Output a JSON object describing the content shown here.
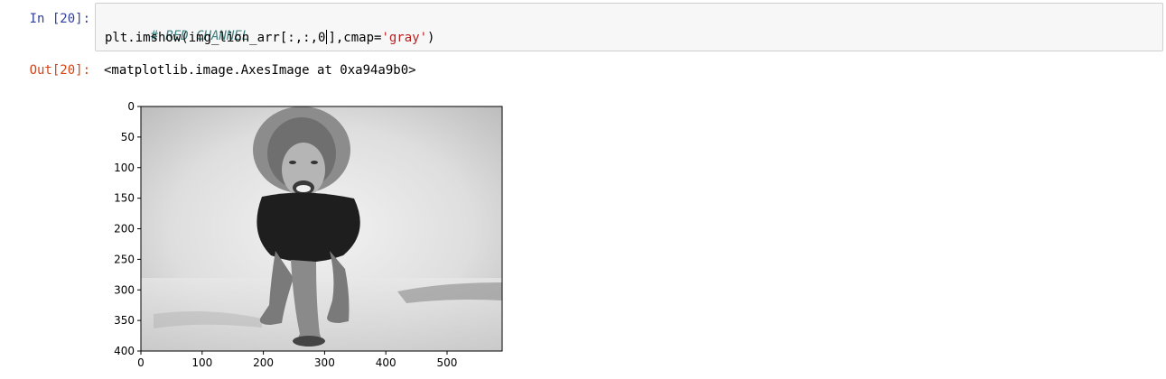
{
  "cell": {
    "in_prompt": "In [20]:",
    "out_prompt": "Out[20]:",
    "code_comment": "# RED CHANNEL",
    "code_prefix": "plt.imshow(img_lion_arr[:,:,0",
    "code_suffix": "],cmap=",
    "code_string": "'gray'",
    "code_end": ")",
    "output_text": "<matplotlib.image.AxesImage at 0xa94a9b0>"
  },
  "figure": {
    "image_description_icon": "grayscale-lion-photo",
    "y_ticks": [
      "0",
      "50",
      "100",
      "150",
      "200",
      "250",
      "300",
      "350",
      "400"
    ],
    "x_ticks": [
      "0",
      "100",
      "200",
      "300",
      "400",
      "500"
    ]
  }
}
